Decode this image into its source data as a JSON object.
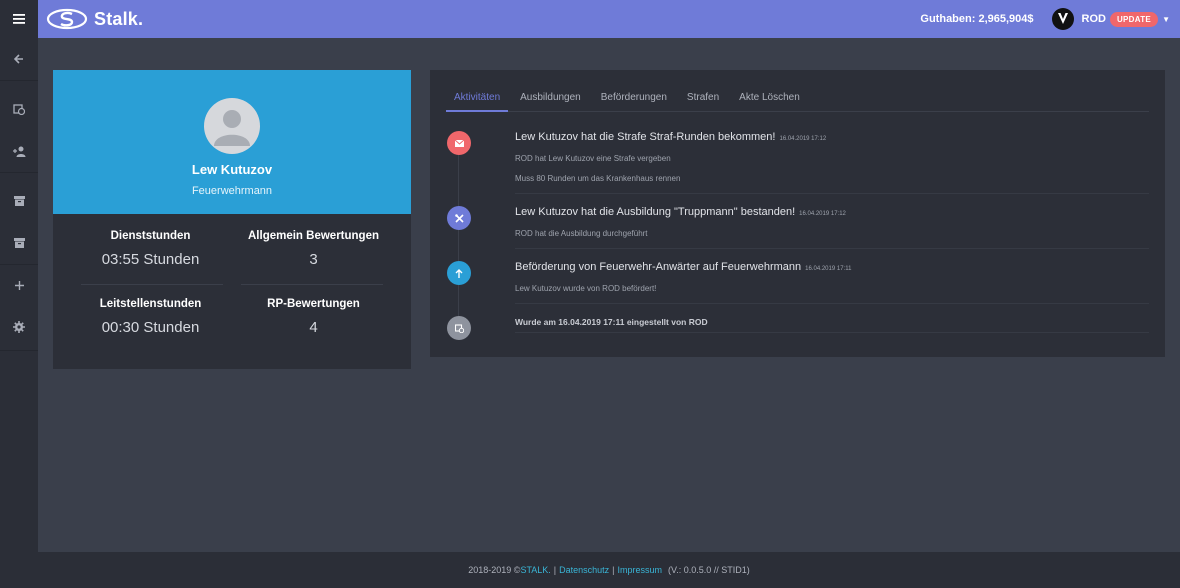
{
  "app": {
    "brand": "Stalk."
  },
  "topbar": {
    "balance": "Guthaben: 2,965,904$",
    "user": "ROD",
    "update_badge": "UPDATE"
  },
  "sidebar": {
    "items": [
      {
        "icon": "menu-icon"
      },
      {
        "icon": "arrow-left-icon"
      },
      {
        "icon": "calendar-clock-icon"
      },
      {
        "icon": "user-add-icon"
      },
      {
        "icon": "archive-icon"
      },
      {
        "icon": "archive-icon"
      },
      {
        "icon": "plus-icon"
      },
      {
        "icon": "gear-icon"
      }
    ]
  },
  "profile": {
    "name": "Lew Kutuzov",
    "role": "Feuerwehrmann",
    "stats": [
      {
        "label": "Dienststunden",
        "value": "03:55 Stunden"
      },
      {
        "label": "Allgemein Bewertungen",
        "value": "3"
      },
      {
        "label": "Leitstellenstunden",
        "value": "00:30 Stunden"
      },
      {
        "label": "RP-Bewertungen",
        "value": "4"
      }
    ]
  },
  "tabs": [
    "Aktivitäten",
    "Ausbildungen",
    "Beförderungen",
    "Strafen",
    "Akte Löschen"
  ],
  "activities": [
    {
      "icon": "mail-icon",
      "color": "#f0676b",
      "title": "Lew Kutuzov hat die Strafe Straf-Runden bekommen!",
      "date": "16.04.2019 17:12",
      "lines": [
        "ROD hat Lew Kutuzov eine Strafe vergeben",
        "Muss 80 Runden um das Krankenhaus rennen"
      ]
    },
    {
      "icon": "tools-icon",
      "color": "#6f7bd8",
      "title": "Lew Kutuzov hat die Ausbildung \"Truppmann\" bestanden!",
      "date": "16.04.2019 17:12",
      "lines": [
        "ROD hat die Ausbildung durchgeführt"
      ]
    },
    {
      "icon": "arrow-up-icon",
      "color": "#2a9fd6",
      "title": "Beförderung von Feuerwehr-Anwärter auf Feuerwehrmann",
      "date": "16.04.2019 17:11",
      "lines": [
        "Lew Kutuzov wurde von ROD befördert!"
      ]
    },
    {
      "icon": "calendar-clock-icon",
      "color": "#8e939e",
      "bold": "Wurde am 16.04.2019 17:11 eingestellt von ROD"
    }
  ],
  "footer": {
    "copyright": "2018-2019 © ",
    "brand_link": "STALK.",
    "privacy": "Datenschutz",
    "imprint": "Impressum",
    "version": "(V.: 0.0.5.0 // STID1)"
  }
}
